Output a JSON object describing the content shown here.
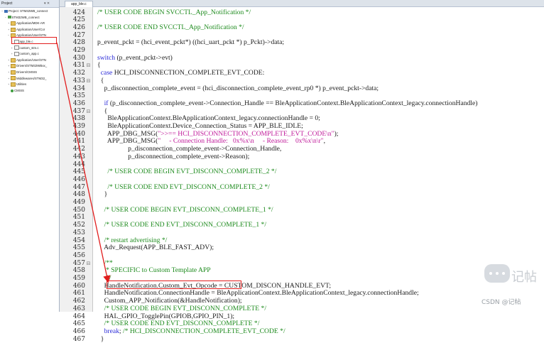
{
  "project_panel": {
    "header": "Project",
    "controls": "▾ ✕",
    "tree": [
      {
        "label": "Project: STM32WB_connect",
        "icon": "proj",
        "indent": 0,
        "toggle": "−"
      },
      {
        "label": "STM32WB_connect",
        "icon": "grp",
        "indent": 1,
        "toggle": "−"
      },
      {
        "label": "Application/MDK-AR",
        "icon": "folder",
        "indent": 2,
        "toggle": "+"
      },
      {
        "label": "Application/User/Cor",
        "icon": "folder",
        "indent": 2,
        "toggle": "+"
      },
      {
        "label": "Application/User/STN",
        "icon": "folder",
        "indent": 2,
        "toggle": "−"
      },
      {
        "label": "app_ble.c",
        "icon": "file",
        "indent": 3,
        "toggle": "+"
      },
      {
        "label": "custom_stm.c",
        "icon": "file",
        "indent": 3,
        "toggle": "+"
      },
      {
        "label": "custom_app.c",
        "icon": "file",
        "indent": 3,
        "toggle": "+"
      },
      {
        "label": "Application/User/STN",
        "icon": "folder",
        "indent": 2,
        "toggle": "+"
      },
      {
        "label": "Drivers/STM32WBxx_",
        "icon": "folder",
        "indent": 2,
        "toggle": "+"
      },
      {
        "label": "Drivers/CMSIS",
        "icon": "folder",
        "indent": 2,
        "toggle": "+"
      },
      {
        "label": "Middlewares/STM32_",
        "icon": "folder",
        "indent": 2,
        "toggle": "+"
      },
      {
        "label": "Utilities",
        "icon": "folder",
        "indent": 2,
        "toggle": "+"
      },
      {
        "label": "CMSIS",
        "icon": "dot",
        "indent": 2,
        "toggle": ""
      }
    ]
  },
  "editor": {
    "tab_label": "app_ble.c",
    "lines": [
      {
        "n": "424",
        "f": "",
        "parts": [
          {
            "t": "/* USER CODE BEGIN SVCCTL_App_Notification */",
            "k": "comment"
          }
        ]
      },
      {
        "n": "425",
        "f": "",
        "parts": []
      },
      {
        "n": "426",
        "f": "",
        "parts": [
          {
            "t": "/* USER CODE END SVCCTL_App_Notification */",
            "k": "comment"
          }
        ]
      },
      {
        "n": "427",
        "f": "",
        "parts": []
      },
      {
        "n": "428",
        "f": "",
        "parts": [
          {
            "t": "p_event_pckt = (hci_event_pckt*) ((hci_uart_pckt *) p_Pckt)->data;",
            "k": "plain"
          }
        ]
      },
      {
        "n": "429",
        "f": "",
        "parts": []
      },
      {
        "n": "430",
        "f": "",
        "parts": [
          {
            "t": "switch",
            "k": "keyword"
          },
          {
            "t": " (p_event_pckt->evt)",
            "k": "plain"
          }
        ]
      },
      {
        "n": "431",
        "f": "⊟",
        "parts": [
          {
            "t": "{",
            "k": "plain"
          }
        ]
      },
      {
        "n": "432",
        "f": "",
        "parts": [
          {
            "t": "  ",
            "k": "plain"
          },
          {
            "t": "case",
            "k": "keyword"
          },
          {
            "t": " HCI_DISCONNECTION_COMPLETE_EVT_CODE:",
            "k": "plain"
          }
        ]
      },
      {
        "n": "433",
        "f": "⊟",
        "parts": [
          {
            "t": "  {",
            "k": "plain"
          }
        ]
      },
      {
        "n": "434",
        "f": "",
        "parts": [
          {
            "t": "    p_disconnection_complete_event = (hci_disconnection_complete_event_rp0 *) p_event_pckt->data;",
            "k": "plain"
          }
        ]
      },
      {
        "n": "435",
        "f": "",
        "parts": []
      },
      {
        "n": "436",
        "f": "",
        "parts": [
          {
            "t": "    ",
            "k": "plain"
          },
          {
            "t": "if",
            "k": "keyword"
          },
          {
            "t": " (p_disconnection_complete_event->Connection_Handle == BleApplicationContext.BleApplicationContext_legacy.connectionHandle)",
            "k": "plain"
          }
        ]
      },
      {
        "n": "437",
        "f": "⊟",
        "parts": [
          {
            "t": "    {",
            "k": "plain"
          }
        ]
      },
      {
        "n": "438",
        "f": "",
        "parts": [
          {
            "t": "      BleApplicationContext.BleApplicationContext_legacy.connectionHandle = 0;",
            "k": "plain"
          }
        ]
      },
      {
        "n": "439",
        "f": "",
        "parts": [
          {
            "t": "      BleApplicationContext.Device_Connection_Status = APP_BLE_IDLE;",
            "k": "plain"
          }
        ]
      },
      {
        "n": "440",
        "f": "",
        "parts": [
          {
            "t": "      APP_DBG_MSG(",
            "k": "plain"
          },
          {
            "t": "\">>== HCI_DISCONNECTION_COMPLETE_EVT_CODE\\n\"",
            "k": "string"
          },
          {
            "t": ");",
            "k": "plain"
          }
        ]
      },
      {
        "n": "441",
        "f": "",
        "parts": [
          {
            "t": "      APP_DBG_MSG(",
            "k": "plain"
          },
          {
            "t": "\"     - Connection Handle:   0x%x\\n     - Reason:    0x%x\\n\\r\"",
            "k": "string"
          },
          {
            "t": ",",
            "k": "plain"
          }
        ]
      },
      {
        "n": "442",
        "f": "",
        "parts": [
          {
            "t": "                  p_disconnection_complete_event->Connection_Handle,",
            "k": "plain"
          }
        ]
      },
      {
        "n": "443",
        "f": "",
        "parts": [
          {
            "t": "                  p_disconnection_complete_event->Reason);",
            "k": "plain"
          }
        ]
      },
      {
        "n": "444",
        "f": "",
        "parts": []
      },
      {
        "n": "445",
        "f": "",
        "parts": [
          {
            "t": "      /* USER CODE BEGIN EVT_DISCONN_COMPLETE_2 */",
            "k": "comment"
          }
        ]
      },
      {
        "n": "446",
        "f": "",
        "parts": []
      },
      {
        "n": "447",
        "f": "",
        "parts": [
          {
            "t": "      /* USER CODE END EVT_DISCONN_COMPLETE_2 */",
            "k": "comment"
          }
        ]
      },
      {
        "n": "448",
        "f": "",
        "parts": [
          {
            "t": "    }",
            "k": "plain"
          }
        ]
      },
      {
        "n": "449",
        "f": "",
        "parts": []
      },
      {
        "n": "450",
        "f": "",
        "parts": [
          {
            "t": "    /* USER CODE BEGIN EVT_DISCONN_COMPLETE_1 */",
            "k": "comment"
          }
        ]
      },
      {
        "n": "451",
        "f": "",
        "parts": []
      },
      {
        "n": "452",
        "f": "",
        "parts": [
          {
            "t": "    /* USER CODE END EVT_DISCONN_COMPLETE_1 */",
            "k": "comment"
          }
        ]
      },
      {
        "n": "453",
        "f": "",
        "parts": []
      },
      {
        "n": "454",
        "f": "",
        "parts": [
          {
            "t": "    /* restart advertising */",
            "k": "comment"
          }
        ]
      },
      {
        "n": "455",
        "f": "",
        "parts": [
          {
            "t": "    Adv_Request(APP_BLE_FAST_ADV);",
            "k": "plain"
          }
        ]
      },
      {
        "n": "456",
        "f": "",
        "parts": []
      },
      {
        "n": "457",
        "f": "⊟",
        "parts": [
          {
            "t": "    /**",
            "k": "comment"
          }
        ]
      },
      {
        "n": "458",
        "f": "",
        "parts": [
          {
            "t": "     * SPECIFIC to Custom Template APP",
            "k": "comment"
          }
        ]
      },
      {
        "n": "459",
        "f": "",
        "parts": [
          {
            "t": "     */",
            "k": "comment"
          }
        ]
      },
      {
        "n": "460",
        "f": "",
        "parts": [
          {
            "t": "    HandleNotification.Custom_Evt_Opcode = CUSTOM_DISCON_HANDLE_EVT;",
            "k": "plain"
          }
        ]
      },
      {
        "n": "461",
        "f": "",
        "parts": [
          {
            "t": "    HandleNotification.ConnectionHandle = BleApplicationContext.BleApplicationContext_legacy.connectionHandle;",
            "k": "plain"
          }
        ]
      },
      {
        "n": "462",
        "f": "",
        "parts": [
          {
            "t": "    Custom_APP_Notification(&HandleNotification);",
            "k": "plain"
          }
        ]
      },
      {
        "n": "463",
        "f": "",
        "parts": [
          {
            "t": "    /* USER CODE BEGIN EVT_DISCONN_COMPLETE */",
            "k": "comment"
          }
        ]
      },
      {
        "n": "464",
        "f": "",
        "parts": [
          {
            "t": "    HAL_GPIO_TogglePin(GPIOB,GPIO_PIN_1);",
            "k": "plain"
          }
        ]
      },
      {
        "n": "465",
        "f": "",
        "parts": [
          {
            "t": "    /* USER CODE END EVT_DISCONN_COMPLETE */",
            "k": "comment"
          }
        ]
      },
      {
        "n": "466",
        "f": "",
        "parts": [
          {
            "t": "    ",
            "k": "plain"
          },
          {
            "t": "break",
            "k": "keyword"
          },
          {
            "t": "; ",
            "k": "plain"
          },
          {
            "t": "/* HCI_DISCONNECTION_COMPLETE_EVT_CODE */",
            "k": "comment"
          }
        ]
      },
      {
        "n": "467",
        "f": "",
        "parts": [
          {
            "t": "  }",
            "k": "plain"
          }
        ]
      }
    ]
  },
  "watermark": {
    "title": "记帖",
    "subtitle": "CSDN @记帖"
  }
}
